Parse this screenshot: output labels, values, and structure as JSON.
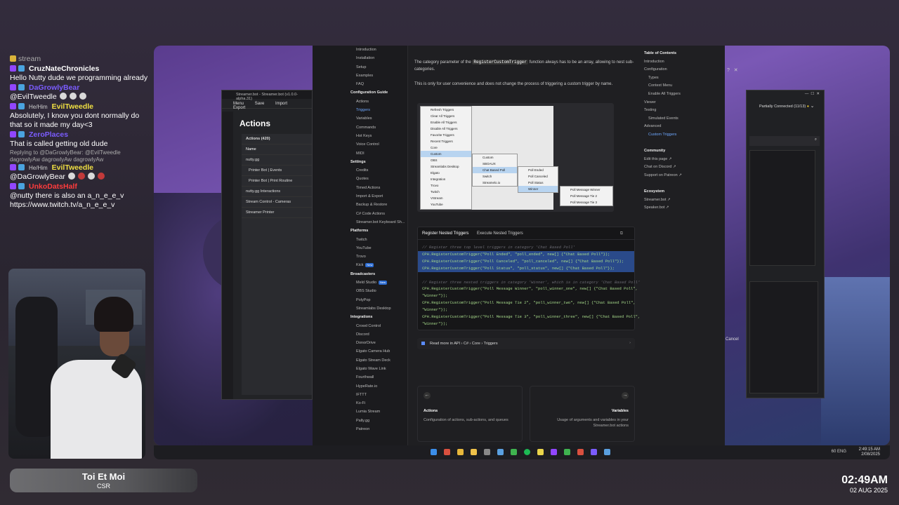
{
  "chat": {
    "header": "stream",
    "messages": [
      {
        "user": "CruzNateChronicles",
        "color": "#ffffff",
        "text": "Hello Nutty dude we programming already"
      },
      {
        "user": "DaGrowlyBear",
        "color": "#7b5cff",
        "text": "@EvilTweedle"
      },
      {
        "user": "EvilTweedle",
        "pronoun": "He/Him",
        "color": "#f0e042",
        "text": "Absolutely, I know you dont normally do that so it made my day<3"
      },
      {
        "user": "ZeroPlaces",
        "color": "#7b5cff",
        "text": "That is called getting old dude"
      },
      {
        "user": "EvilTweedle",
        "pronoun": "He/Him",
        "color": "#f0e042",
        "reply": "Replying to @DaGrowlyBear: @EvilTweedle dagrowlyAw dagrowlyAw dagrowlyAw",
        "text": "@DaGrowlyBear"
      },
      {
        "user": "UnkoDatsHalf",
        "color": "#ff3c3c",
        "text": "@nutty there is also an a_n_e_e_v https://www.twitch.tv/a_n_e_e_v"
      }
    ]
  },
  "nameplate": {
    "name": "Toi Et Moi",
    "sub": "CSR"
  },
  "clock": {
    "time": "02:49AM",
    "date": "02 AUG 2025"
  },
  "streamerbot": {
    "title": "Streamer.bot - Streamer.bot (v1.0.0-alpha.31)",
    "menu": [
      "Menu",
      "Save",
      "Import",
      "Export"
    ],
    "heading": "Actions",
    "tab": "Actions (420)",
    "column": "Name",
    "rows": [
      "nutty.gg",
      "Printer Bot | Events",
      "Printer Bot | Print Routine",
      "nutty.gg Interactions",
      "Stream Control - Cameras",
      "Streamer Printer"
    ]
  },
  "docs": {
    "nav": [
      {
        "label": "Introduction"
      },
      {
        "label": "Installation"
      },
      {
        "label": "Setup"
      },
      {
        "label": "Examples"
      },
      {
        "label": "FAQ"
      },
      {
        "label": "Configuration Guide",
        "sec": true
      },
      {
        "label": "Actions"
      },
      {
        "label": "Triggers",
        "active": true
      },
      {
        "label": "Variables"
      },
      {
        "label": "Commands"
      },
      {
        "label": "Hot Keys"
      },
      {
        "label": "Voice Control"
      },
      {
        "label": "MIDI"
      },
      {
        "label": "Settings",
        "sec": true
      },
      {
        "label": "Credits"
      },
      {
        "label": "Quotes"
      },
      {
        "label": "Timed Actions"
      },
      {
        "label": "Import & Export"
      },
      {
        "label": "Backup & Restore"
      },
      {
        "label": "C# Code Actions"
      },
      {
        "label": "Streamer.bot Keyboard Sh..."
      },
      {
        "label": "Platforms",
        "sec": true
      },
      {
        "label": "Twitch"
      },
      {
        "label": "YouTube"
      },
      {
        "label": "Trovo"
      },
      {
        "label": "Kick",
        "badge": "New"
      },
      {
        "label": "Broadcasters",
        "sec": true
      },
      {
        "label": "Meld Studio",
        "badge": "New"
      },
      {
        "label": "OBS Studio"
      },
      {
        "label": "PolyPop"
      },
      {
        "label": "Streamlabs Desktop"
      },
      {
        "label": "Integrations",
        "sec": true
      },
      {
        "label": "Crowd Control"
      },
      {
        "label": "Discord"
      },
      {
        "label": "DonorDrive"
      },
      {
        "label": "Elgato Camera Hub"
      },
      {
        "label": "Elgato Stream Deck"
      },
      {
        "label": "Elgato Wave Link"
      },
      {
        "label": "Fourthwall"
      },
      {
        "label": "HypeRate.io"
      },
      {
        "label": "IFTTT"
      },
      {
        "label": "Ko-Fi"
      },
      {
        "label": "Lumia Stream"
      },
      {
        "label": "Pally.gg"
      },
      {
        "label": "Patreon"
      }
    ],
    "para1_a": "The category parameter of the",
    "para1_kw": "RegisterCustomTrigger",
    "para1_b": "function always has to be an array, allowing to nest sub-categories.",
    "para2": "This is only for user convenience and does not change the process of triggering a custom trigger by name.",
    "menu1": [
      "Refresh Triggers",
      "Clear All Triggers",
      "Enable All Triggers",
      "Disable All Triggers",
      "Favorite Triggers",
      "Recent Triggers",
      "Core",
      "Custom",
      "OBS",
      "Streamlabs Desktop",
      "Elgato",
      "Integration",
      "Trovo",
      "Twitch",
      "VStream",
      "YouTube"
    ],
    "menu2": [
      "Custom",
      "SBOAUX",
      "Chat Based Poll",
      "Switch",
      "Streamelo.io"
    ],
    "menu3": [
      "Poll Ended",
      "Poll Canceled",
      "Poll Status",
      "Winner"
    ],
    "menu4": [
      "Poll Message Winner",
      "Poll Message Tie 2",
      "Poll Message Tie 3"
    ],
    "code_tabs": [
      "Register Nested Triggers",
      "Execute Nested Triggers"
    ],
    "code": [
      {
        "t": "// Register three top level triggers in category 'Chat Based Poll'",
        "k": "c"
      },
      {
        "t": "CPH.RegisterCustomTrigger(\"Poll Ended\", \"poll_ended\", new[] {\"Chat Based Poll\"});",
        "k": "s"
      },
      {
        "t": "CPH.RegisterCustomTrigger(\"Poll Canceled\", \"poll_canceled\", new[] {\"Chat Based Poll\"});",
        "k": "s"
      },
      {
        "t": "CPH.RegisterCustomTrigger(\"Poll Status\", \"poll_status\", new[] {\"Chat Based Poll\"});",
        "k": "s"
      },
      {
        "t": "",
        "k": "n"
      },
      {
        "t": "// Register three nested triggers in category 'Winner', which is in category 'Chat Based Poll'",
        "k": "c"
      },
      {
        "t": "CPH.RegisterCustomTrigger(\"Poll Message Winner\", \"poll_winner_one\", new[] {\"Chat Based Poll\",",
        "k": "n"
      },
      {
        "t": "\"Winner\"});",
        "k": "n"
      },
      {
        "t": "CPH.RegisterCustomTrigger(\"Poll Message Tie 2\", \"poll_winner_two\", new[] {\"Chat Based Poll\",",
        "k": "n"
      },
      {
        "t": "\"Winner\"});",
        "k": "n"
      },
      {
        "t": "CPH.RegisterCustomTrigger(\"Poll Message Tie 3\", \"poll_winner_three\", new[] {\"Chat Based Poll\",",
        "k": "n"
      },
      {
        "t": "\"Winner\"});",
        "k": "n"
      }
    ],
    "readmore": "Read more in API › C# › Core › Triggers",
    "prev": {
      "title": "Actions",
      "desc": "Configuration of actions, sub-actions, and queues"
    },
    "next": {
      "title": "Variables",
      "desc": "Usage of arguments and variables in your Streamer.bot actions"
    },
    "toc": [
      {
        "label": "Table of Contents",
        "sec": true
      },
      {
        "label": "Introduction"
      },
      {
        "label": "Configuration"
      },
      {
        "label": "Types"
      },
      {
        "label": "Context Menu"
      },
      {
        "label": "Enable All Triggers"
      },
      {
        "label": "Viewer"
      },
      {
        "label": "Testing"
      },
      {
        "label": "Simulated Events"
      },
      {
        "label": "Advanced"
      },
      {
        "label": "Custom Triggers",
        "active": true
      },
      {
        "label": ""
      },
      {
        "label": "Community",
        "sec": true
      },
      {
        "label": "Edit this page ↗"
      },
      {
        "label": "Chat on Discord ↗"
      },
      {
        "label": "Support on Patreon ↗"
      },
      {
        "label": ""
      },
      {
        "label": "Ecosystem",
        "sec": true
      },
      {
        "label": "Streamer.bot ↗"
      },
      {
        "label": "Speaker.bot ↗"
      }
    ]
  },
  "rightwin": {
    "status": "Partially Connected (11/13)",
    "cancel": "Cancel"
  },
  "taskbar": {
    "time": "2:49:15 AM",
    "date": "2/08/2025",
    "lang": "ENG",
    "vol": "60"
  }
}
